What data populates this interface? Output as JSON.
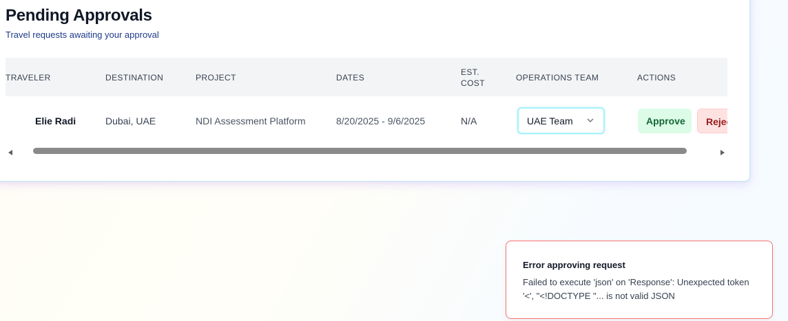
{
  "header": {
    "title": "Pending Approvals",
    "subtitle": "Travel requests awaiting your approval"
  },
  "table": {
    "columns": [
      "TRAVELER",
      "DESTINATION",
      "PROJECT",
      "DATES",
      "EST. COST",
      "OPERATIONS TEAM",
      "ACTIONS"
    ],
    "rows": [
      {
        "traveler": "Elie Radi",
        "destination": "Dubai, UAE",
        "project": "NDI Assessment Platform",
        "dates": "8/20/2025 - 9/6/2025",
        "est_cost": "N/A",
        "operations_team": "UAE Team",
        "approve_label": "Approve",
        "reject_label": "Reject"
      }
    ]
  },
  "toast": {
    "title": "Error approving request",
    "message": "Failed to execute 'json' on 'Response': Unexpected token '<', \"<!DOCTYPE \"... is not valid JSON"
  },
  "colors": {
    "approve_bg": "#dcfce7",
    "approve_text": "#166534",
    "reject_bg": "#fee2e2",
    "reject_text": "#991b1b",
    "toast_border": "#f87171",
    "select_border": "#a5f3fc"
  },
  "icons": {
    "select_chevron": "chevron-down-icon",
    "scroll_left": "scroll-left-arrow-icon",
    "scroll_right": "scroll-right-arrow-icon"
  }
}
